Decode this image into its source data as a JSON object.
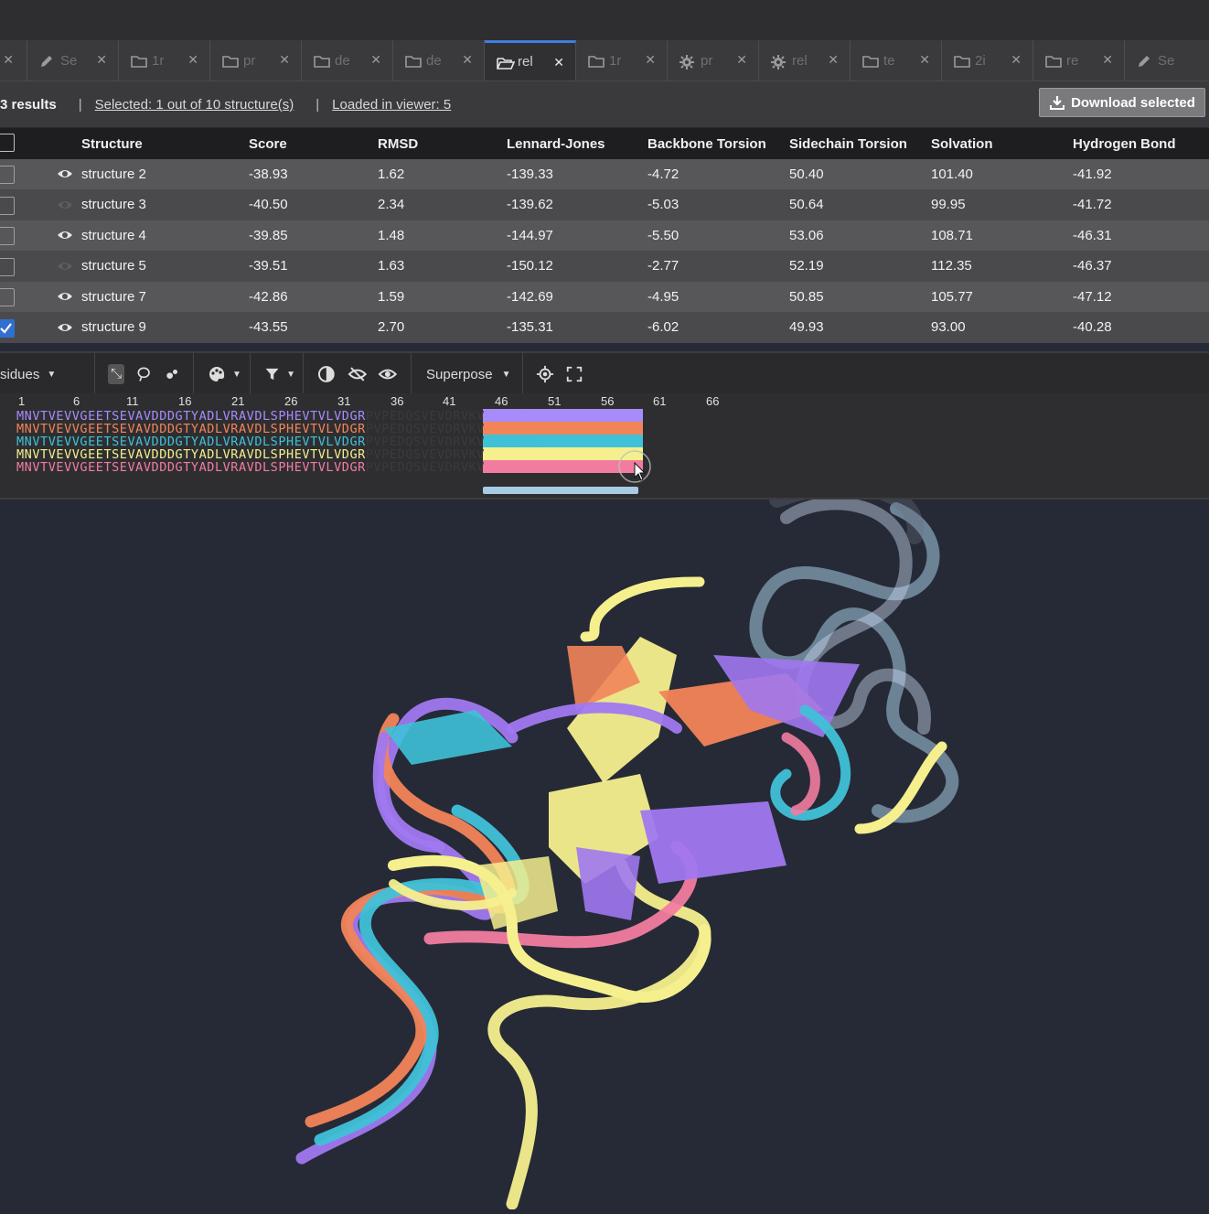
{
  "tabs": [
    {
      "icon": "close-icon",
      "label": "",
      "active": false
    },
    {
      "icon": "pencil-icon",
      "label": "Se",
      "active": false
    },
    {
      "icon": "folder-icon",
      "label": "1r",
      "active": false
    },
    {
      "icon": "folder-icon",
      "label": "pr",
      "active": false
    },
    {
      "icon": "folder-icon",
      "label": "de",
      "active": false
    },
    {
      "icon": "folder-icon",
      "label": "de",
      "active": false
    },
    {
      "icon": "folder-open-icon",
      "label": "rel",
      "active": true
    },
    {
      "icon": "folder-icon",
      "label": "1r",
      "active": false
    },
    {
      "icon": "gear-icon",
      "label": "pr",
      "active": false
    },
    {
      "icon": "gear-icon",
      "label": "rel",
      "active": false
    },
    {
      "icon": "folder-icon",
      "label": "te",
      "active": false
    },
    {
      "icon": "folder-icon",
      "label": "2i",
      "active": false
    },
    {
      "icon": "folder-icon",
      "label": "re",
      "active": false
    },
    {
      "icon": "pencil-icon",
      "label": "Se",
      "active": false
    }
  ],
  "results": {
    "count": "3 results",
    "separator": "|",
    "selected": "Selected: 1 out of 10 structure(s)",
    "loaded": "Loaded in viewer: 5",
    "download": "Download selected"
  },
  "table": {
    "headers": [
      "Structure",
      "Score",
      "RMSD",
      "Lennard-Jones",
      "Backbone Torsion",
      "Sidechain Torsion",
      "Solvation",
      "Hydrogen Bond"
    ],
    "rows": [
      {
        "name": "structure 2",
        "visible": true,
        "checked": false,
        "values": [
          "-38.93",
          "1.62",
          "-139.33",
          "-4.72",
          "50.40",
          "101.40",
          "-41.92"
        ]
      },
      {
        "name": "structure 3",
        "visible": false,
        "checked": false,
        "values": [
          "-40.50",
          "2.34",
          "-139.62",
          "-5.03",
          "50.64",
          "99.95",
          "-41.72"
        ]
      },
      {
        "name": "structure 4",
        "visible": true,
        "checked": false,
        "values": [
          "-39.85",
          "1.48",
          "-144.97",
          "-5.50",
          "53.06",
          "108.71",
          "-46.31"
        ]
      },
      {
        "name": "structure 5",
        "visible": false,
        "checked": false,
        "values": [
          "-39.51",
          "1.63",
          "-150.12",
          "-2.77",
          "52.19",
          "112.35",
          "-46.37"
        ]
      },
      {
        "name": "structure 7",
        "visible": true,
        "checked": false,
        "values": [
          "-42.86",
          "1.59",
          "-142.69",
          "-4.95",
          "50.85",
          "105.77",
          "-47.12"
        ]
      },
      {
        "name": "structure 9",
        "visible": true,
        "checked": true,
        "values": [
          "-43.55",
          "2.70",
          "-135.31",
          "-6.02",
          "49.93",
          "93.00",
          "-40.28"
        ]
      }
    ]
  },
  "toolbar": {
    "residues_label": "sidues",
    "superpose_label": "Superpose"
  },
  "sequence": {
    "ruler": [
      "1",
      "6",
      "11",
      "16",
      "21",
      "26",
      "31",
      "36",
      "41",
      "46",
      "51",
      "56",
      "61",
      "66"
    ],
    "prefix": "MNVTVEVVGEETSEVAVDDDGTYADLVRAVDLSPHEVTVLVDGR",
    "highlight": "PVPEDQSVEVDRVKV",
    "suffix": "LRLIKGG",
    "line_colors": [
      "#a78bfa",
      "#f2845a",
      "#3fc1d8",
      "#f5ef8e",
      "#f27ca0"
    ],
    "highlight_text_color": "#3a3a3a"
  },
  "viewer": {
    "chain_colors": [
      "#f5ef8e",
      "#f2845a",
      "#a078f0",
      "#3fc1d8",
      "#f27ca0",
      "#a6cbe3"
    ]
  }
}
